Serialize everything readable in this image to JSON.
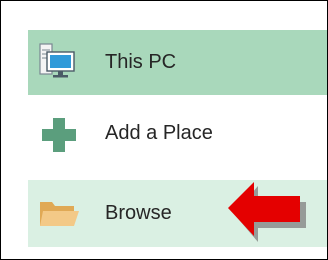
{
  "places": {
    "items": [
      {
        "label": "This PC",
        "icon": "computer-icon",
        "state": "selected"
      },
      {
        "label": "Add a Place",
        "icon": "plus-icon",
        "state": "normal"
      },
      {
        "label": "Browse",
        "icon": "folder-icon",
        "state": "hover"
      }
    ]
  },
  "colors": {
    "selected_bg": "#a9d8bb",
    "hover_bg": "#daf0e3",
    "plus_green": "#5b9e7d",
    "folder": "#e8b567",
    "annotation_arrow": "#e40000",
    "border": "#000000"
  },
  "annotation": {
    "icon": "red-arrow-icon",
    "points_to": "Browse"
  }
}
